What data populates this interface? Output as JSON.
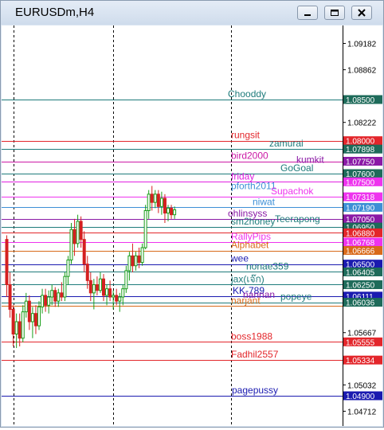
{
  "window": {
    "title": "EURUSDm,H4"
  },
  "chart_data": {
    "type": "candlestick",
    "symbol": "EURUSDm",
    "timeframe": "H4",
    "ylim": [
      1.0455,
      1.0935
    ],
    "y_ticks": [
      "1.09182",
      "1.08862",
      "1.08222",
      "1.05667",
      "1.05032",
      "1.04712"
    ],
    "levels": [
      {
        "name": "Chooddy",
        "price": 1.085,
        "price_label": "1.08500",
        "color": "#1e7b7b",
        "badge": "#1e6b5a"
      },
      {
        "name": "rungsit",
        "price": 1.08,
        "price_label": "1.08000",
        "color": "#e3262b",
        "badge": "#e3262b"
      },
      {
        "name": "zamurai",
        "price": 1.07898,
        "price_label": "1.07898",
        "color": "#1e7b7b",
        "badge": "#1e6b5a"
      },
      {
        "name": "bird2000",
        "price": 1.0775,
        "price_label": "1.07750",
        "color": "#cc1aa6",
        "badge": "#8b1aa6"
      },
      {
        "name": "kumkit",
        "price": 1.077,
        "price_label": "",
        "color": "#8b1aa6",
        "badge": ""
      },
      {
        "name": "GoGoal",
        "price": 1.076,
        "price_label": "1.07600",
        "color": "#1e7b7b",
        "badge": "#1e6b5a"
      },
      {
        "name": "friday",
        "price": 1.075,
        "price_label": "1.07500",
        "color": "#e020e0",
        "badge": "#ee33ee"
      },
      {
        "name": "pforth2011",
        "price": 1.0738,
        "price_label": "",
        "color": "#3d8fd6",
        "badge": ""
      },
      {
        "name": "Supachok",
        "price": 1.07318,
        "price_label": "1.07318",
        "color": "#ee33ee",
        "badge": "#ee33ee"
      },
      {
        "name": "niwat",
        "price": 1.0719,
        "price_label": "1.07190",
        "color": "#3d8fd6",
        "badge": "#3d8fd6"
      },
      {
        "name": "ohlinsyss",
        "price": 1.0705,
        "price_label": "1.07050",
        "color": "#8b1aa6",
        "badge": "#8b1aa6"
      },
      {
        "name": "Teerapong",
        "price": 1.0698,
        "price_label": "",
        "color": "#1e7b7b",
        "badge": ""
      },
      {
        "name": "sm2honey",
        "price": 1.0695,
        "price_label": "1.06950",
        "color": "#1e7b7b",
        "badge": "#1e6b5a"
      },
      {
        "name": "",
        "price": 1.0688,
        "price_label": "1.06880",
        "color": "#e3262b",
        "badge": "#e3262b"
      },
      {
        "name": "RallyPips",
        "price": 1.06768,
        "price_label": "1.06768",
        "color": "#ee33ee",
        "badge": "#ee33ee"
      },
      {
        "name": "Alphabet",
        "price": 1.06666,
        "price_label": "1.06666",
        "color": "#d96a1a",
        "badge": "#d96a1a"
      },
      {
        "name": "wee",
        "price": 1.065,
        "price_label": "1.06500",
        "color": "#1a1ab0",
        "badge": "#1a1ab0"
      },
      {
        "name": "nonae359",
        "price": 1.06405,
        "price_label": "1.06405",
        "color": "#1e7b7b",
        "badge": "#1e6b5a"
      },
      {
        "name": "jax(เจ๊ก)",
        "price": 1.0625,
        "price_label": "1.06250",
        "color": "#1e7b7b",
        "badge": "#1e6b5a"
      },
      {
        "name": "KK-789",
        "price": 1.06111,
        "price_label": "1.06111",
        "color": "#1a1ab0",
        "badge": "#1a1ab0"
      },
      {
        "name": "nannan",
        "price": 1.0606,
        "price_label": "",
        "color": "#8b1aa6",
        "badge": ""
      },
      {
        "name": "popeye",
        "price": 1.06036,
        "price_label": "1.06036",
        "color": "#1e7b7b",
        "badge": "#1e6b5a"
      },
      {
        "name": "narjant",
        "price": 1.0599,
        "price_label": "",
        "color": "#d96a1a",
        "badge": "#d96a1a"
      },
      {
        "name": "boss1988",
        "price": 1.05555,
        "price_label": "1.05555",
        "color": "#e3262b",
        "badge": "#e3262b"
      },
      {
        "name": "Fadhil2557",
        "price": 1.05334,
        "price_label": "1.05334",
        "color": "#e3262b",
        "badge": "#e3262b"
      },
      {
        "name": "pagepussy",
        "price": 1.049,
        "price_label": "1.04900",
        "color": "#1a1ab0",
        "badge": "#1a1ab0"
      }
    ],
    "candles": [
      [
        1.068,
        1.0685,
        1.061,
        1.0625
      ],
      [
        1.0625,
        1.064,
        1.0585,
        1.0595
      ],
      [
        1.0595,
        1.06,
        1.055,
        1.0565
      ],
      [
        1.0565,
        1.059,
        1.0548,
        1.058
      ],
      [
        1.058,
        1.059,
        1.055,
        1.056
      ],
      [
        1.056,
        1.06,
        1.0555,
        1.0592
      ],
      [
        1.0592,
        1.0615,
        1.0585,
        1.0605
      ],
      [
        1.0605,
        1.0612,
        1.057,
        1.058
      ],
      [
        1.058,
        1.0598,
        1.056,
        1.059
      ],
      [
        1.059,
        1.06,
        1.0565,
        1.0575
      ],
      [
        1.0575,
        1.0605,
        1.057,
        1.0598
      ],
      [
        1.0598,
        1.062,
        1.059,
        1.0612
      ],
      [
        1.0612,
        1.062,
        1.0592,
        1.06
      ],
      [
        1.06,
        1.0618,
        1.059,
        1.061
      ],
      [
        1.061,
        1.0625,
        1.06,
        1.0618
      ],
      [
        1.0618,
        1.0622,
        1.0598,
        1.0605
      ],
      [
        1.0605,
        1.062,
        1.0598,
        1.0615
      ],
      [
        1.0615,
        1.0628,
        1.0605,
        1.061
      ],
      [
        1.061,
        1.064,
        1.0605,
        1.0635
      ],
      [
        1.0635,
        1.066,
        1.0625,
        1.0655
      ],
      [
        1.0655,
        1.07,
        1.065,
        1.0692
      ],
      [
        1.0692,
        1.0705,
        1.066,
        1.0675
      ],
      [
        1.0675,
        1.071,
        1.067,
        1.0702
      ],
      [
        1.0702,
        1.0708,
        1.067,
        1.068
      ],
      [
        1.068,
        1.069,
        1.064,
        1.065
      ],
      [
        1.065,
        1.066,
        1.062,
        1.063
      ],
      [
        1.063,
        1.064,
        1.0605,
        1.0615
      ],
      [
        1.0615,
        1.0632,
        1.0595,
        1.0625
      ],
      [
        1.0625,
        1.0635,
        1.0612,
        1.0618
      ],
      [
        1.0618,
        1.064,
        1.0615,
        1.0632
      ],
      [
        1.0632,
        1.0638,
        1.0605,
        1.0612
      ],
      [
        1.0612,
        1.0625,
        1.06,
        1.062
      ],
      [
        1.062,
        1.063,
        1.0605,
        1.061
      ],
      [
        1.061,
        1.0618,
        1.0595,
        1.0612
      ],
      [
        1.0612,
        1.062,
        1.06,
        1.0605
      ],
      [
        1.0605,
        1.0615,
        1.0592,
        1.061
      ],
      [
        1.061,
        1.0625,
        1.06,
        1.062
      ],
      [
        1.062,
        1.0648,
        1.0615,
        1.0642
      ],
      [
        1.0642,
        1.0665,
        1.063,
        1.066
      ],
      [
        1.066,
        1.0675,
        1.064,
        1.0648
      ],
      [
        1.0648,
        1.0665,
        1.0642,
        1.066
      ],
      [
        1.066,
        1.067,
        1.0645,
        1.0652
      ],
      [
        1.0652,
        1.0675,
        1.0648,
        1.067
      ],
      [
        1.067,
        1.0722,
        1.0668,
        1.0715
      ],
      [
        1.0715,
        1.074,
        1.0705,
        1.0735
      ],
      [
        1.0735,
        1.0745,
        1.0715,
        1.0725
      ],
      [
        1.0725,
        1.074,
        1.0718,
        1.0735
      ],
      [
        1.0735,
        1.074,
        1.0712,
        1.072
      ],
      [
        1.072,
        1.0738,
        1.071,
        1.073
      ],
      [
        1.073,
        1.0735,
        1.07,
        1.0712
      ],
      [
        1.0712,
        1.0722,
        1.0702,
        1.0718
      ],
      [
        1.0718,
        1.0722,
        1.0705,
        1.071
      ],
      [
        1.071,
        1.072,
        1.0705,
        1.0716
      ]
    ]
  }
}
